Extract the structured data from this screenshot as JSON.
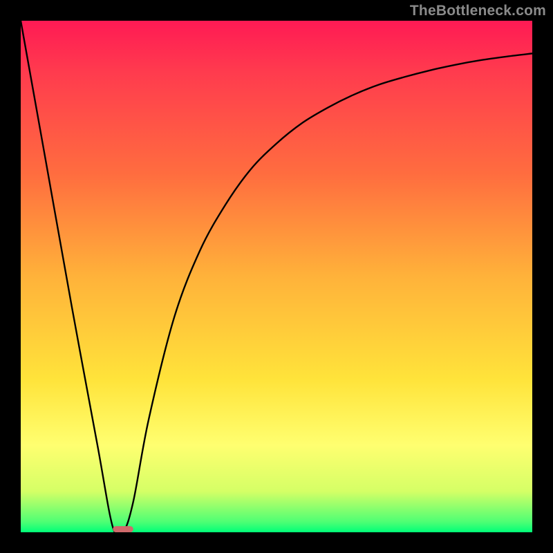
{
  "attribution": "TheBottleneck.com",
  "colors": {
    "frame_border": "#000000",
    "gradient_stops": [
      "#ff1a54",
      "#ff3b4e",
      "#ff6d3f",
      "#ffb23a",
      "#ffe33a",
      "#ffff70",
      "#d5ff66",
      "#4dff74",
      "#00ff78"
    ],
    "curve": "#000000",
    "marker": "#cf6a6b"
  },
  "chart_data": {
    "type": "line",
    "title": "",
    "xlabel": "",
    "ylabel": "",
    "xlim": [
      0,
      100
    ],
    "ylim": [
      0,
      100
    ],
    "grid": false,
    "legend": false,
    "x": [
      0,
      5,
      10,
      15,
      18,
      20,
      22,
      25,
      30,
      35,
      40,
      45,
      50,
      55,
      60,
      65,
      70,
      75,
      80,
      85,
      90,
      95,
      100
    ],
    "series": [
      {
        "name": "bottleneck_curve",
        "values": [
          100,
          72,
          44,
          17,
          1,
          0,
          6,
          22,
          42,
          55,
          64,
          71,
          76,
          80,
          83,
          85.5,
          87.5,
          89,
          90.3,
          91.4,
          92.3,
          93,
          93.6
        ]
      }
    ],
    "marker": {
      "x": 20,
      "y": 0,
      "width": 4,
      "height": 1.2
    }
  }
}
